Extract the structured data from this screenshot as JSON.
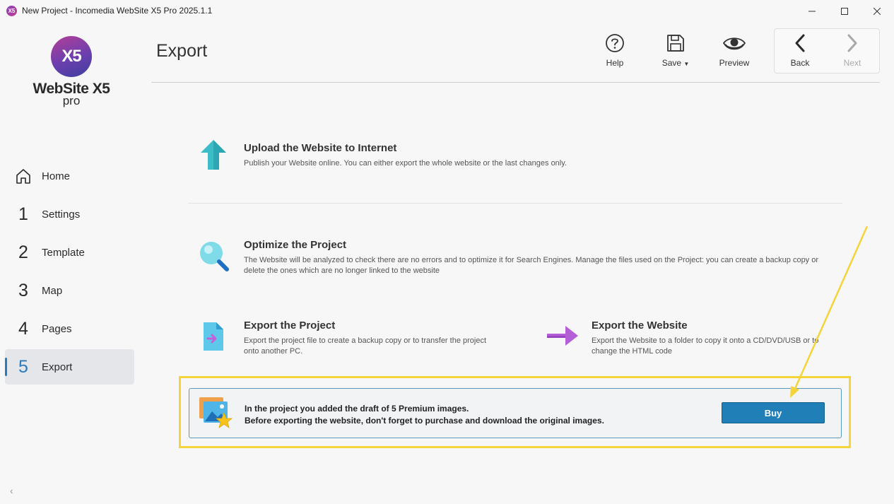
{
  "window": {
    "title": "New Project - Incomedia WebSite X5 Pro 2025.1.1",
    "app_icon_text": "X5"
  },
  "sidebar": {
    "logo_text": "X5",
    "brand_name": "WebSite X5",
    "brand_edition": "pro",
    "items": [
      {
        "num": "",
        "icon": "home-icon",
        "label": "Home"
      },
      {
        "num": "1",
        "label": "Settings"
      },
      {
        "num": "2",
        "label": "Template"
      },
      {
        "num": "3",
        "label": "Map"
      },
      {
        "num": "4",
        "label": "Pages"
      },
      {
        "num": "5",
        "label": "Export",
        "active": true
      }
    ],
    "collapse_glyph": "‹"
  },
  "header": {
    "title": "Export",
    "toolbar": {
      "help": "Help",
      "save": "Save",
      "preview": "Preview",
      "back": "Back",
      "next": "Next"
    }
  },
  "sections": {
    "upload": {
      "title": "Upload the Website to Internet",
      "desc": "Publish your Website online. You can either export the whole website or the last changes only."
    },
    "optimize": {
      "title": "Optimize the Project",
      "desc": "The Website will be analyzed to check there are no errors and to optimize it for Search Engines. Manage the files used on the Project: you can create a backup copy or delete the ones which are no longer linked to the website"
    },
    "export_project": {
      "title": "Export the Project",
      "desc": "Export the project file to create a backup copy or to transfer the project onto another PC."
    },
    "export_website": {
      "title": "Export the Website",
      "desc": "Export the Website to a folder to copy it onto a CD/DVD/USB or to change the HTML code"
    }
  },
  "notice": {
    "line1": "In the project you added the draft of 5 Premium images.",
    "line2": "Before exporting the website, don't forget to purchase and download the original images.",
    "button": "Buy"
  },
  "colors": {
    "accent": "#2a7bbd",
    "highlight": "#f5d33a",
    "buy_button": "#1f7fb6",
    "upload_arrow": "#3cbcc6",
    "export_arrow": "#b45fd6"
  }
}
